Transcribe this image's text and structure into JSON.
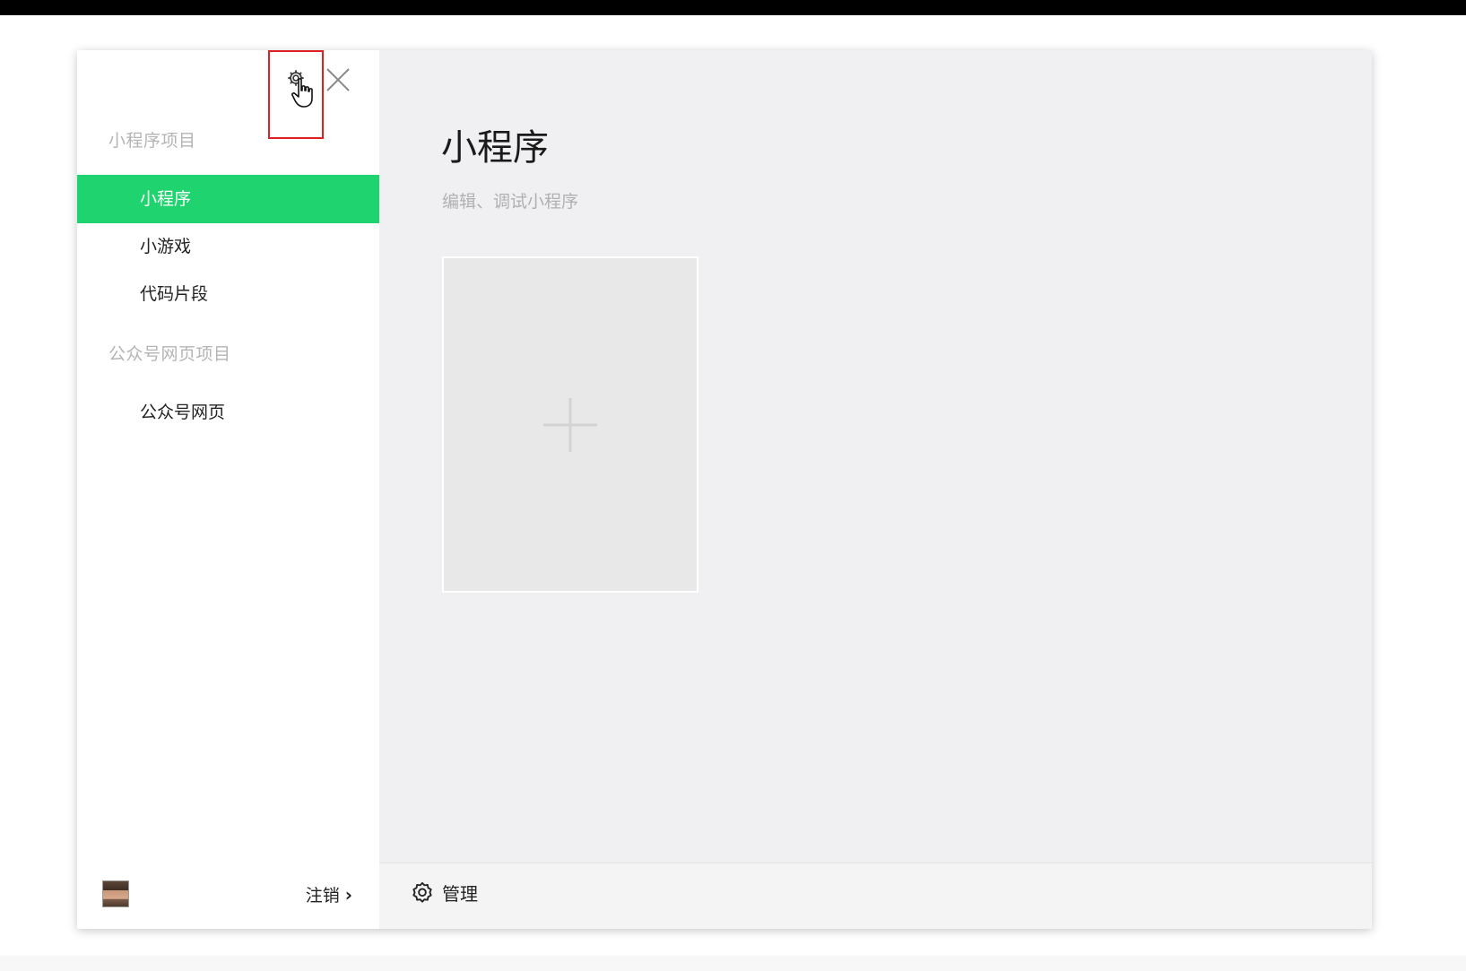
{
  "sidebar": {
    "sections": [
      {
        "title": "小程序项目",
        "items": [
          {
            "label": "小程序",
            "active": true
          },
          {
            "label": "小游戏",
            "active": false
          },
          {
            "label": "代码片段",
            "active": false
          }
        ]
      },
      {
        "title": "公众号网页项目",
        "items": [
          {
            "label": "公众号网页",
            "active": false
          }
        ]
      }
    ],
    "logout_label": "注销",
    "logout_chevron": "›"
  },
  "main": {
    "title": "小程序",
    "subtitle": "编辑、调试小程序",
    "footer": {
      "manage_label": "管理"
    }
  },
  "icons": {
    "settings": "gear-icon",
    "close": "close-icon",
    "add": "plus-icon",
    "manage": "gear-icon",
    "cursor": "hand-pointer-icon"
  },
  "colors": {
    "accent": "#1fd36f",
    "highlight_box": "#e02020",
    "main_bg": "#f0f0f3"
  }
}
